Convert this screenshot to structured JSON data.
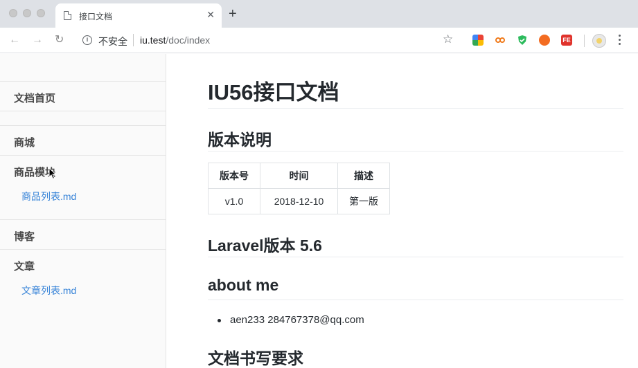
{
  "browser": {
    "tab_title": "接口文档",
    "tab_close": "✕",
    "new_tab": "+",
    "security_label": "不安全",
    "url_host": "iu.test",
    "url_path": "/doc/index",
    "back_icon": "←",
    "forward_icon": "→",
    "reload_icon": "↻",
    "info_icon": "i",
    "star_icon": "☆",
    "extensions": [
      {
        "name": "chrome-ext-multicolor-icon",
        "color": "#ea4335"
      },
      {
        "name": "infinity-ext-icon",
        "color": "#f07a1a"
      },
      {
        "name": "shield-ext-icon",
        "color": "#2dbb5d"
      },
      {
        "name": "rocket-ext-icon",
        "color": "#f36c21"
      },
      {
        "name": "fe-ext-icon",
        "color": "#e0332c"
      }
    ],
    "fe_ext_label": "FE"
  },
  "sidebar": {
    "home": "文档首页",
    "sections": [
      {
        "title": "商城",
        "group": "商品模块",
        "link": "商品列表.md"
      },
      {
        "title": "博客",
        "group": "文章",
        "link": "文章列表.md"
      }
    ]
  },
  "content": {
    "title": "IU56接口文档",
    "version_heading": "版本说明",
    "table": {
      "headers": [
        "版本号",
        "时间",
        "描述"
      ],
      "rows": [
        [
          "v1.0",
          "2018-12-10",
          "第一版"
        ]
      ]
    },
    "laravel_heading": "Laravel版本 5.6",
    "about_heading": "about me",
    "about_items": [
      "aen233 284767378@qq.com"
    ],
    "writing_heading": "文档书写要求"
  },
  "colors": {
    "link": "#3884d8",
    "sidebar_bg": "#fafafa",
    "tabbar_bg": "#dee1e6"
  }
}
